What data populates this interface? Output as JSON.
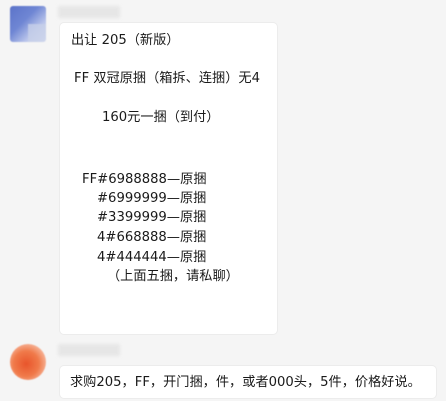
{
  "messages": [
    {
      "lines": [
        "出让  205（新版）",
        "FF 双冠原捆（箱拆、连捆）无4",
        "160元一捆（到付）",
        "FF#6988888—原捆",
        "#6999999—原捆",
        "#3399999—原捆",
        "4#668888—原捆",
        "4#444444—原捆",
        "（上面五捆，请私聊）"
      ]
    },
    {
      "lines": [
        "求购205，FF，开门捆，件，或者000头，5件，价格好说。"
      ]
    }
  ]
}
